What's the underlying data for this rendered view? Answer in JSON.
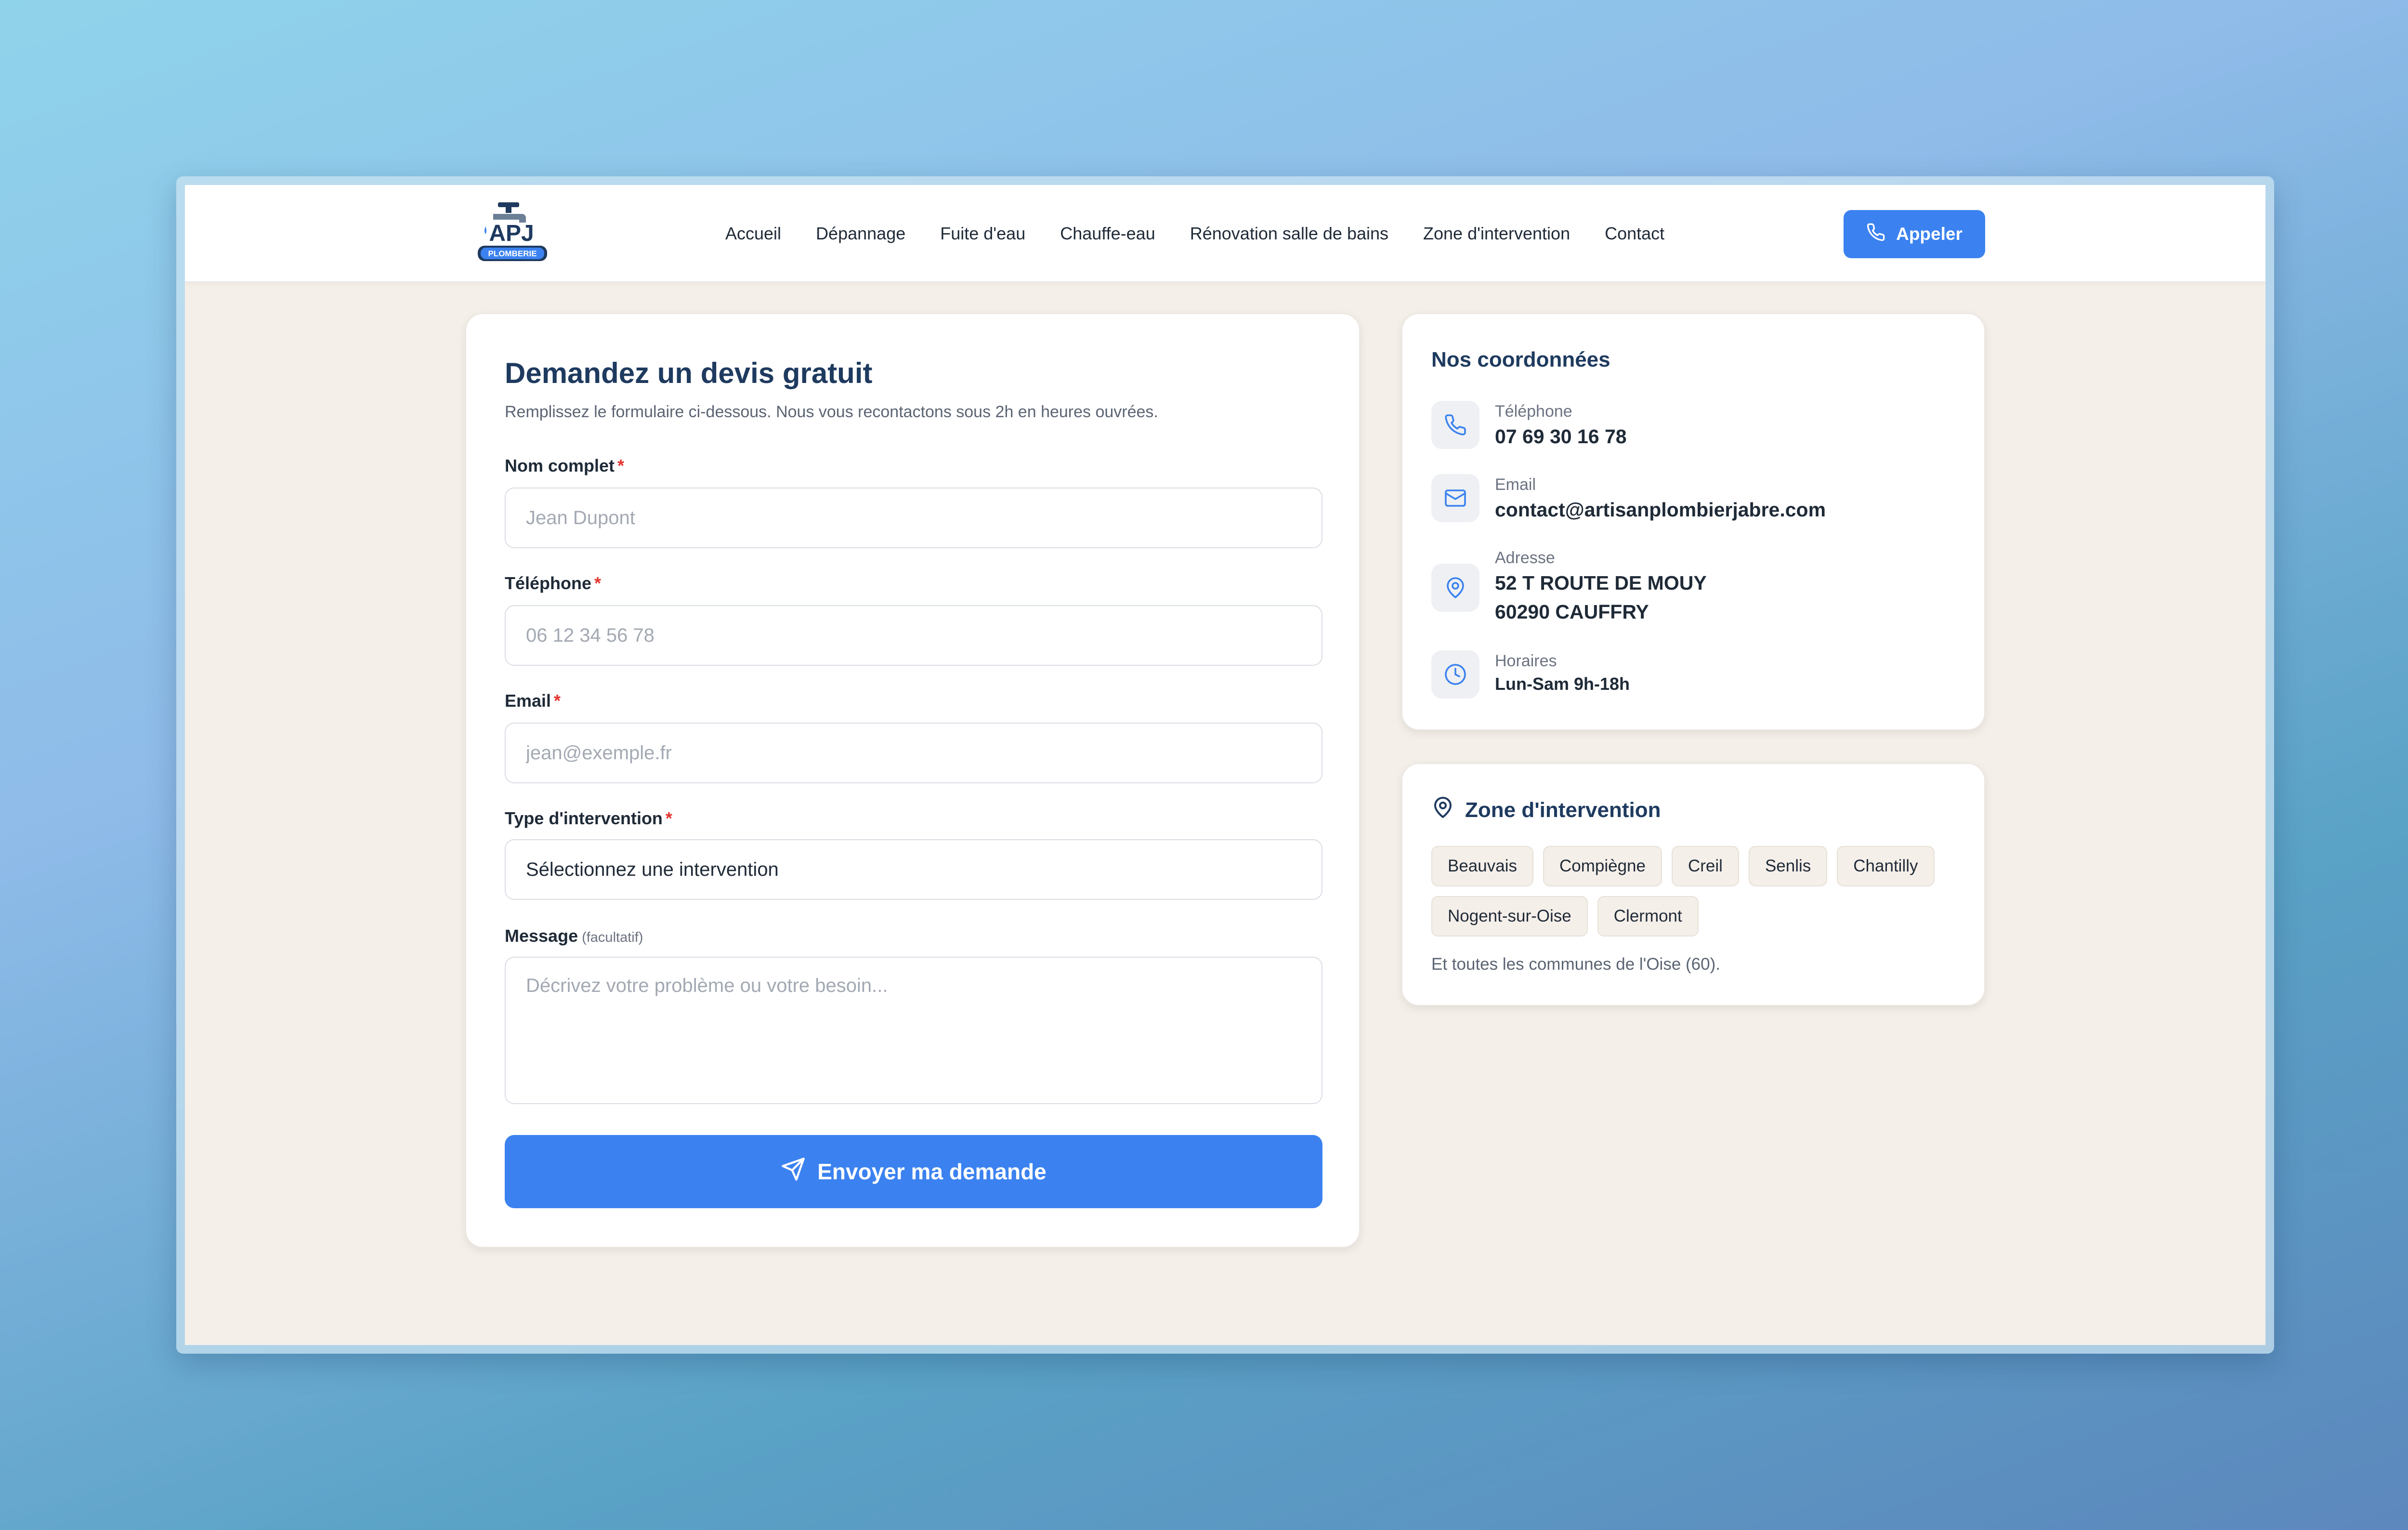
{
  "brand": {
    "logo_text": "APJ",
    "logo_sub": "PLOMBERIE"
  },
  "nav": {
    "links": [
      "Accueil",
      "Dépannage",
      "Fuite d'eau",
      "Chauffe-eau",
      "Rénovation salle de bains",
      "Zone d'intervention",
      "Contact"
    ],
    "call_label": "Appeler"
  },
  "form": {
    "title": "Demandez un devis gratuit",
    "subtitle": "Remplissez le formulaire ci-dessous. Nous vous recontactons sous 2h en heures ouvrées.",
    "name_label": "Nom complet",
    "name_placeholder": "Jean Dupont",
    "phone_label": "Téléphone",
    "phone_placeholder": "06 12 34 56 78",
    "email_label": "Email",
    "email_placeholder": "jean@exemple.fr",
    "type_label": "Type d'intervention",
    "type_value": "Sélectionnez une intervention",
    "message_label": "Message",
    "message_optional": "(facultatif)",
    "message_placeholder": "Décrivez votre problème ou votre besoin...",
    "required_mark": "*",
    "submit_label": "Envoyer ma demande"
  },
  "contact": {
    "heading": "Nos coordonnées",
    "phone_label": "Téléphone",
    "phone_value": "07 69 30 16 78",
    "email_label": "Email",
    "email_value": "contact@artisanplombierjabre.com",
    "address_label": "Adresse",
    "address_line1": "52 T ROUTE DE MOUY",
    "address_line2": "60290 CAUFFRY",
    "hours_label": "Horaires",
    "hours_value": "Lun-Sam 9h-18h"
  },
  "zone": {
    "heading": "Zone d'intervention",
    "cities": [
      "Beauvais",
      "Compiègne",
      "Creil",
      "Senlis",
      "Chantilly",
      "Nogent-sur-Oise",
      "Clermont"
    ],
    "note": "Et toutes les communes de l'Oise (60)."
  },
  "colors": {
    "accent": "#3b82f0",
    "heading": "#1e3a5f",
    "page_bg": "#f5efe9"
  },
  "icons": {
    "call": "phone-icon",
    "submit": "send-icon",
    "phone": "phone-icon",
    "email": "mail-icon",
    "address": "map-pin-icon",
    "hours": "clock-icon",
    "zone": "map-pin-icon"
  }
}
